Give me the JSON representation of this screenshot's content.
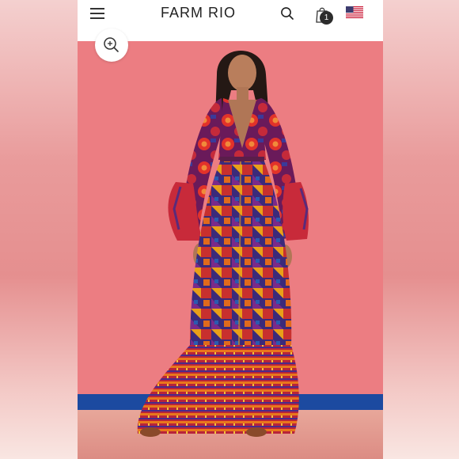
{
  "header": {
    "brand_name": "FARM RIO",
    "cart_count": "1",
    "menu_icon": "hamburger-menu-icon",
    "search_icon": "search-icon",
    "cart_icon": "shopping-bag-icon",
    "flag_icon": "us-flag-icon"
  },
  "product_image": {
    "zoom_icon": "zoom-in-icon"
  },
  "colors": {
    "wall": "#ec7d82",
    "stripe": "#1c4aa0",
    "header_bg": "#ffffff"
  }
}
